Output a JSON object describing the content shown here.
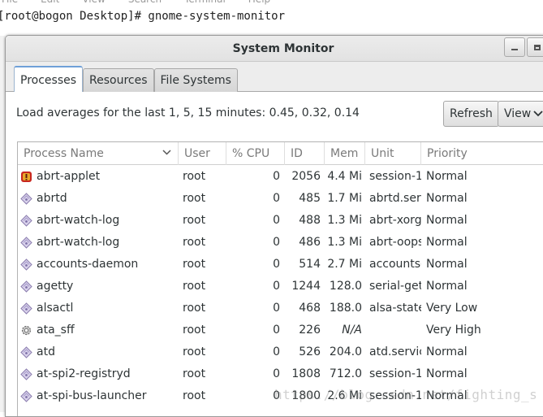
{
  "terminal": {
    "menu": [
      "File",
      "Edit",
      "View",
      "Search",
      "Terminal",
      "Help"
    ],
    "command_line": "[root@bogon Desktop]# gnome-system-monitor"
  },
  "window": {
    "title": "System Monitor"
  },
  "tabs": [
    {
      "label": "Processes",
      "active": true
    },
    {
      "label": "Resources",
      "active": false
    },
    {
      "label": "File Systems",
      "active": false
    }
  ],
  "toolbar": {
    "load_averages": "Load averages for the last 1, 5, 15 minutes: 0.45, 0.32, 0.14",
    "refresh_label": "Refresh",
    "view_label": "View"
  },
  "table": {
    "columns": [
      "Process Name",
      "User",
      "% CPU",
      "ID",
      "Mem",
      "Unit",
      "Priority"
    ],
    "rows": [
      {
        "icon": "alert-app-icon",
        "name": "abrt-applet",
        "user": "root",
        "cpu": "0",
        "id": "2056",
        "mem": "4.4 Mi",
        "unit": "session-1",
        "priority": "Normal"
      },
      {
        "icon": "diamond-process-icon",
        "name": "abrtd",
        "user": "root",
        "cpu": "0",
        "id": "485",
        "mem": "1.7 Mi",
        "unit": "abrtd.serv",
        "priority": "Normal"
      },
      {
        "icon": "diamond-process-icon",
        "name": "abrt-watch-log",
        "user": "root",
        "cpu": "0",
        "id": "488",
        "mem": "1.3 Mi",
        "unit": "abrt-xorg",
        "priority": "Normal"
      },
      {
        "icon": "diamond-process-icon",
        "name": "abrt-watch-log",
        "user": "root",
        "cpu": "0",
        "id": "486",
        "mem": "1.3 Mi",
        "unit": "abrt-oops",
        "priority": "Normal"
      },
      {
        "icon": "diamond-process-icon",
        "name": "accounts-daemon",
        "user": "root",
        "cpu": "0",
        "id": "514",
        "mem": "2.7 Mi",
        "unit": "accounts-",
        "priority": "Normal"
      },
      {
        "icon": "diamond-process-icon",
        "name": "agetty",
        "user": "root",
        "cpu": "0",
        "id": "1244",
        "mem": "128.0",
        "unit": "serial-get",
        "priority": "Normal"
      },
      {
        "icon": "diamond-process-icon",
        "name": "alsactl",
        "user": "root",
        "cpu": "0",
        "id": "468",
        "mem": "188.0",
        "unit": "alsa-state",
        "priority": "Very Low"
      },
      {
        "icon": "gear-process-icon",
        "name": "ata_sff",
        "user": "root",
        "cpu": "0",
        "id": "226",
        "mem": "N/A",
        "unit": "",
        "priority": "Very High"
      },
      {
        "icon": "diamond-process-icon",
        "name": "atd",
        "user": "root",
        "cpu": "0",
        "id": "526",
        "mem": "204.0",
        "unit": "atd.servic",
        "priority": "Normal"
      },
      {
        "icon": "diamond-process-icon",
        "name": "at-spi2-registryd",
        "user": "root",
        "cpu": "0",
        "id": "1808",
        "mem": "712.0",
        "unit": "session-1",
        "priority": "Normal"
      },
      {
        "icon": "diamond-process-icon",
        "name": "at-spi-bus-launcher",
        "user": "root",
        "cpu": "0",
        "id": "1800",
        "mem": "2.6 Mi",
        "unit": "session-1",
        "priority": "Normal"
      }
    ]
  },
  "watermark": "https://blog.csdn.net/fighting_s"
}
